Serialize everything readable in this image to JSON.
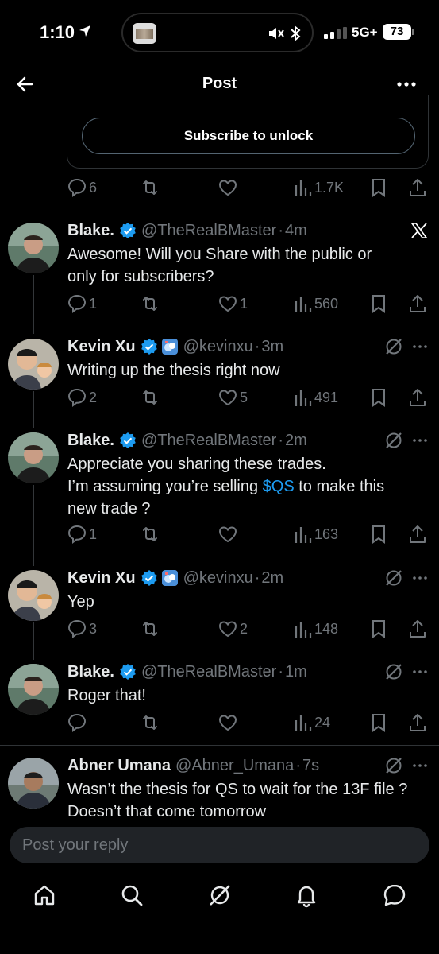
{
  "status": {
    "time": "1:10",
    "network": "5G+",
    "battery": "73"
  },
  "header": {
    "title": "Post"
  },
  "post": {
    "subscribe_label": "Subscribe to unlock",
    "stats": {
      "replies": "6",
      "reposts": "",
      "likes": "",
      "views": "1.7K"
    }
  },
  "replies": [
    {
      "name": "Blake.",
      "handle": "@TheRealBMaster",
      "time": "4m",
      "lines": [
        "Awesome!  Will you Share with the public or",
        "only for subscribers?"
      ],
      "replies": "1",
      "reposts": "",
      "likes": "1",
      "views": "560",
      "corner": "x-logo-icon"
    },
    {
      "name": "Kevin Xu",
      "handle": "@kevinxu",
      "time": "3m",
      "lines": [
        "Writing up the thesis right now"
      ],
      "replies": "2",
      "reposts": "",
      "likes": "5",
      "views": "491",
      "corner": "grok-icon"
    },
    {
      "name": "Blake.",
      "handle": "@TheRealBMaster",
      "time": "2m",
      "line1": "Appreciate you sharing these trades.",
      "line2_pre": "I’m assuming you’re selling ",
      "cashtag": "$QS",
      "line2_post": " to make this",
      "line3": "new trade ?",
      "replies": "1",
      "reposts": "",
      "likes": "",
      "views": "163",
      "corner": "grok-icon"
    },
    {
      "name": "Kevin Xu",
      "handle": "@kevinxu",
      "time": "2m",
      "lines": [
        "Yep"
      ],
      "replies": "3",
      "reposts": "",
      "likes": "2",
      "views": "148",
      "corner": "grok-icon"
    },
    {
      "name": "Blake.",
      "handle": "@TheRealBMaster",
      "time": "1m",
      "lines": [
        "Roger that!"
      ],
      "replies": "",
      "reposts": "",
      "likes": "",
      "views": "24",
      "corner": "grok-icon"
    },
    {
      "name": "Abner Umana",
      "handle": "@Abner_Umana",
      "time": "7s",
      "lines": [
        "Wasn’t the thesis for QS to wait for the 13F file ?",
        "Doesn’t that come tomorrow"
      ],
      "corner": "grok-icon"
    }
  ],
  "composer": {
    "placeholder": "Post your reply"
  },
  "colors": {
    "accent": "#1d9bf0",
    "muted": "#71767b",
    "divider": "#2f3336"
  }
}
